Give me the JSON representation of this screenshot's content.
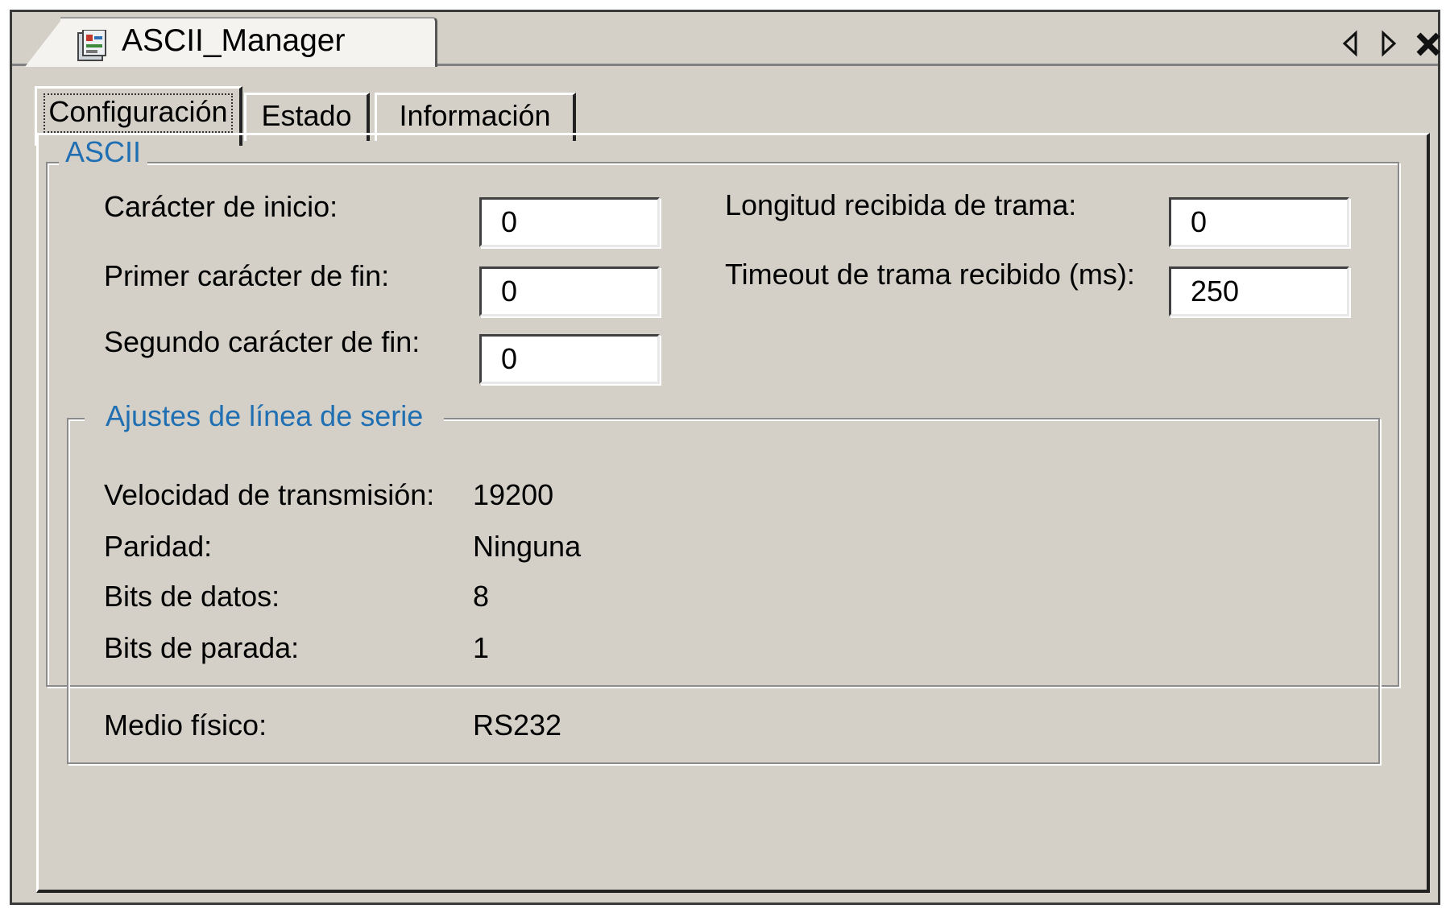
{
  "window": {
    "title": "ASCII_Manager",
    "icon": "document-config-icon"
  },
  "title_bar_controls": {
    "scroll_left_icon": "triangle-left-icon",
    "scroll_right_icon": "triangle-right-icon",
    "close_icon": "close-x-icon"
  },
  "tabs": [
    {
      "label": "Configuración",
      "active": true
    },
    {
      "label": "Estado",
      "active": false
    },
    {
      "label": "Información",
      "active": false
    }
  ],
  "ascii_group": {
    "legend": "ASCII",
    "start_char_label": "Carácter de inicio:",
    "start_char_value": "0",
    "first_end_char_label": "Primer carácter de fin:",
    "first_end_char_value": "0",
    "second_end_char_label": "Segundo carácter de fin:",
    "second_end_char_value": "0",
    "frame_length_label": "Longitud recibida de trama:",
    "frame_length_value": "0",
    "frame_timeout_label": "Timeout de trama recibido (ms):",
    "frame_timeout_value": "250"
  },
  "serial_group": {
    "legend": "Ajustes de línea de serie",
    "rows": [
      {
        "label": "Velocidad de transmisión:",
        "value": "19200"
      },
      {
        "label": "Paridad:",
        "value": "Ninguna"
      },
      {
        "label": "Bits de datos:",
        "value": "8"
      },
      {
        "label": "Bits de parada:",
        "value": "1"
      },
      {
        "label": "Medio físico:",
        "value": "RS232"
      }
    ]
  },
  "colors": {
    "panel_bg": "#d4d0c8",
    "legend_text": "#1f6fb2",
    "field_bg": "#ffffff"
  }
}
